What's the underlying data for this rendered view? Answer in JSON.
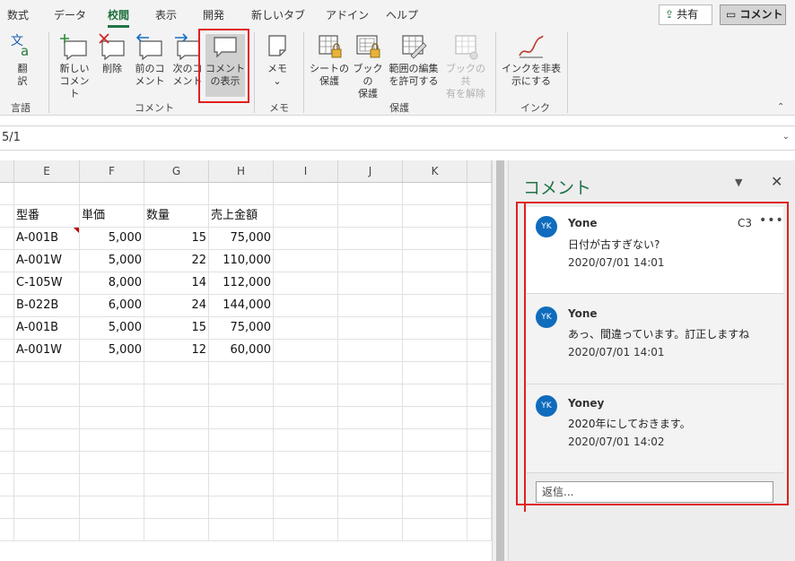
{
  "tabs": [
    {
      "label": "数式"
    },
    {
      "label": "データ"
    },
    {
      "label": "校閲"
    },
    {
      "label": "表示"
    },
    {
      "label": "開発"
    },
    {
      "label": "新しいタブ"
    },
    {
      "label": "アドイン"
    },
    {
      "label": "ヘルプ"
    }
  ],
  "header": {
    "share_label": "共有",
    "comments_label": "コメント"
  },
  "ribbon": {
    "translate": "翻\n訳",
    "new_comment": "新しい\nコメント",
    "delete": "削除",
    "prev_comment": "前のコ\nメント",
    "next_comment": "次のコ\nメント",
    "show_comments": "コメント\nの表示",
    "memo": "メモ",
    "protect_sheet": "シートの\n保護",
    "protect_book": "ブックの\n保護",
    "allow_edit": "範囲の編集\nを許可する",
    "unshare_book": "ブックの共\n有を解除",
    "hide_ink": "インクを非表\n示にする",
    "groups": {
      "language": "言語",
      "comments": "コメント",
      "memo": "メモ",
      "protect": "保護",
      "ink": "インク"
    }
  },
  "formula_bar": {
    "value": "5/1"
  },
  "grid": {
    "columns": [
      "E",
      "F",
      "G",
      "H",
      "I",
      "J",
      "K"
    ],
    "rows": [
      [
        "型番",
        "単価",
        "数量",
        "売上金額"
      ],
      [
        "A-001B",
        "5,000",
        "15",
        "75,000"
      ],
      [
        "A-001W",
        "5,000",
        "22",
        "110,000"
      ],
      [
        "C-105W",
        "8,000",
        "14",
        "112,000"
      ],
      [
        "B-022B",
        "6,000",
        "24",
        "144,000"
      ],
      [
        "A-001B",
        "5,000",
        "15",
        "75,000"
      ],
      [
        "A-001W",
        "5,000",
        "12",
        "60,000"
      ]
    ]
  },
  "comments_pane": {
    "title": "コメント",
    "reply_placeholder": "返信...",
    "comments": [
      {
        "initials": "YK",
        "author": "Yone",
        "text": "日付が古すぎない?",
        "time": "2020/07/01 14:01",
        "cell": "C3"
      },
      {
        "initials": "YK",
        "author": "Yone",
        "text": "あっ、間違っています。訂正しますね",
        "time": "2020/07/01 14:01"
      },
      {
        "initials": "YK",
        "author": "Yoney",
        "text": "2020年にしておきます。",
        "time": "2020/07/01 14:02"
      }
    ]
  },
  "colors": {
    "accent": "#217346",
    "highlight": "#e02020",
    "avatar": "#0f6cbd"
  }
}
